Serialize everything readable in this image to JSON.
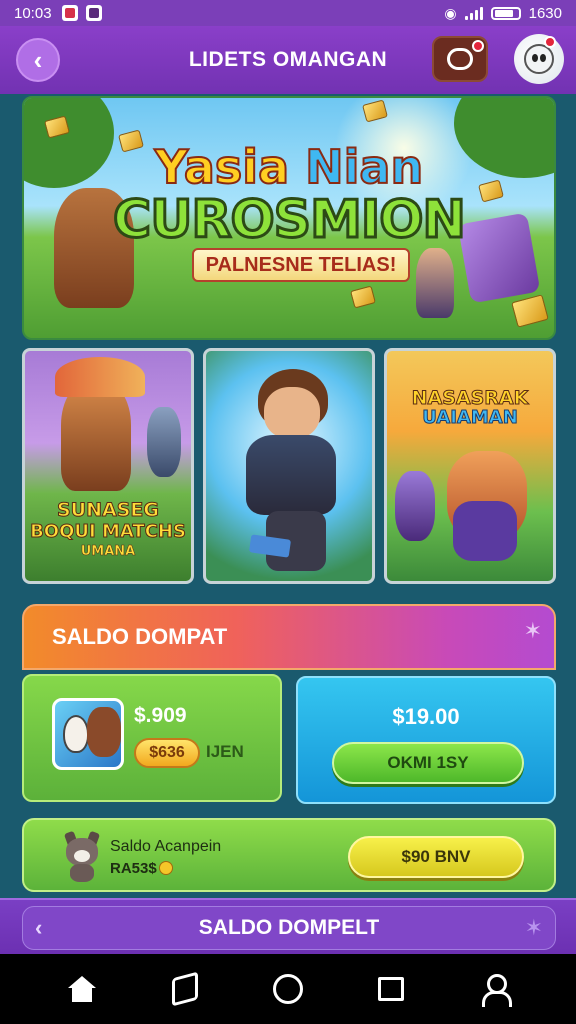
{
  "status_bar": {
    "time": "10:03",
    "right_text": "1630",
    "icons": [
      "notification-app-icon",
      "notification-app-icon",
      "alarm-icon",
      "signal-icon",
      "battery-icon"
    ]
  },
  "header": {
    "title": "LIDETS OMANGAN",
    "back_icon": "chevron-left-icon",
    "chat_icon": "chat-bubble-icon",
    "profile_icon": "avatar-icon"
  },
  "hero": {
    "title_word1": "Yasia",
    "title_word2": "Nian",
    "title_main": "CUROSMION",
    "ribbon": "PALNESNE TELIAS!"
  },
  "game_cards": [
    {
      "label_lines": [
        "SUNASEG",
        "BOQUI MATCHS",
        "UMANA"
      ]
    },
    {
      "label_lines": []
    },
    {
      "label_lines": [
        "NASASRAK",
        "UAIAMAN"
      ]
    }
  ],
  "wallet": {
    "title": "SALDO DOMPAT",
    "star_icon": "star-icon",
    "left_panel": {
      "amount": "$.909",
      "coin_pill": "$636",
      "coin_label": "IJEN"
    },
    "right_panel": {
      "amount": "$19.00",
      "button_label": "OKMI 1SY"
    }
  },
  "row_bar": {
    "title": "Saldo Acanpein",
    "subtitle": "RA53$",
    "button_label": "$90 BNV"
  },
  "bottom_bar": {
    "title": "SALDO DOMPELT",
    "back_icon": "chevron-left-icon",
    "star_icon": "star-icon"
  },
  "nav": {
    "items": [
      "home-icon",
      "app-icon",
      "circle-icon",
      "recents-icon",
      "profile-icon"
    ]
  },
  "colors": {
    "header_purple": "#7b3fb8",
    "green_panel": "#6cc840",
    "blue_panel": "#1fa6e3",
    "yellow_button": "#e8dd30",
    "orange_banner": "#f28b2a"
  }
}
